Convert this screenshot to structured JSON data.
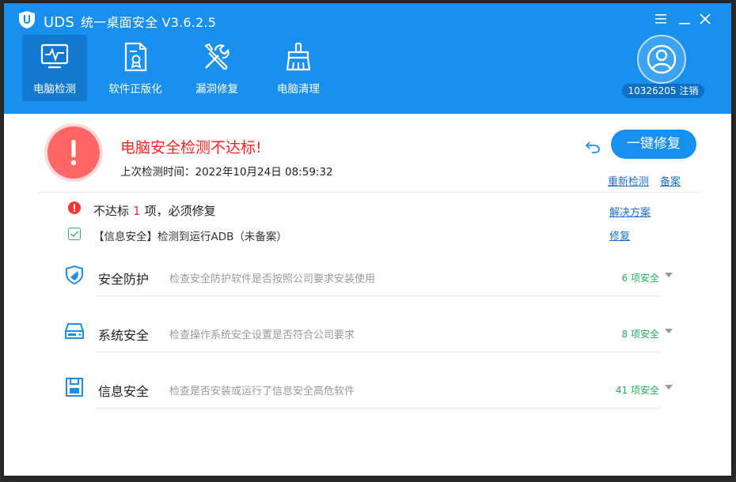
{
  "window": {
    "brand": "UDS",
    "title": "统一桌面安全 V3.6.2.5"
  },
  "nav": [
    {
      "label": "电脑检测",
      "icon": "monitor-pulse-icon",
      "active": true
    },
    {
      "label": "软件正版化",
      "icon": "certificate-document-icon",
      "active": false
    },
    {
      "label": "漏洞修复",
      "icon": "wrench-screwdriver-icon",
      "active": false
    },
    {
      "label": "电脑清理",
      "icon": "broom-icon",
      "active": false
    }
  ],
  "user": {
    "id": "10326205",
    "logout_label": "注销"
  },
  "status": {
    "title": "电脑安全检测不达标!",
    "last_check": "上次检测时间：2022年10月24日 08:59:32",
    "fix_button": "一键修复",
    "recheck_link": "重新检测",
    "register_link": "备案"
  },
  "summary": {
    "prefix": "不达标",
    "count": "1",
    "suffix": "项，必须修复",
    "solution_link": "解决方案",
    "issue_text": "【信息安全】检测到运行ADB（未备案）",
    "issue_fix_link": "修复"
  },
  "categories": [
    {
      "title": "安全防护",
      "desc": "检查安全防护软件是否按照公司要求安装使用",
      "count": "6 项安全",
      "icon": "shield-icon"
    },
    {
      "title": "系统安全",
      "desc": "检查操作系统安全设置是否符合公司要求",
      "count": "8 项安全",
      "icon": "hard-drive-icon"
    },
    {
      "title": "信息安全",
      "desc": "检查是否安装或运行了信息安全高危软件",
      "count": "41 项安全",
      "icon": "floppy-disk-icon"
    }
  ],
  "colors": {
    "header": "#1a90ee",
    "alert": "#ff2222",
    "link": "#1a71d0",
    "safe": "#1fb05d"
  }
}
